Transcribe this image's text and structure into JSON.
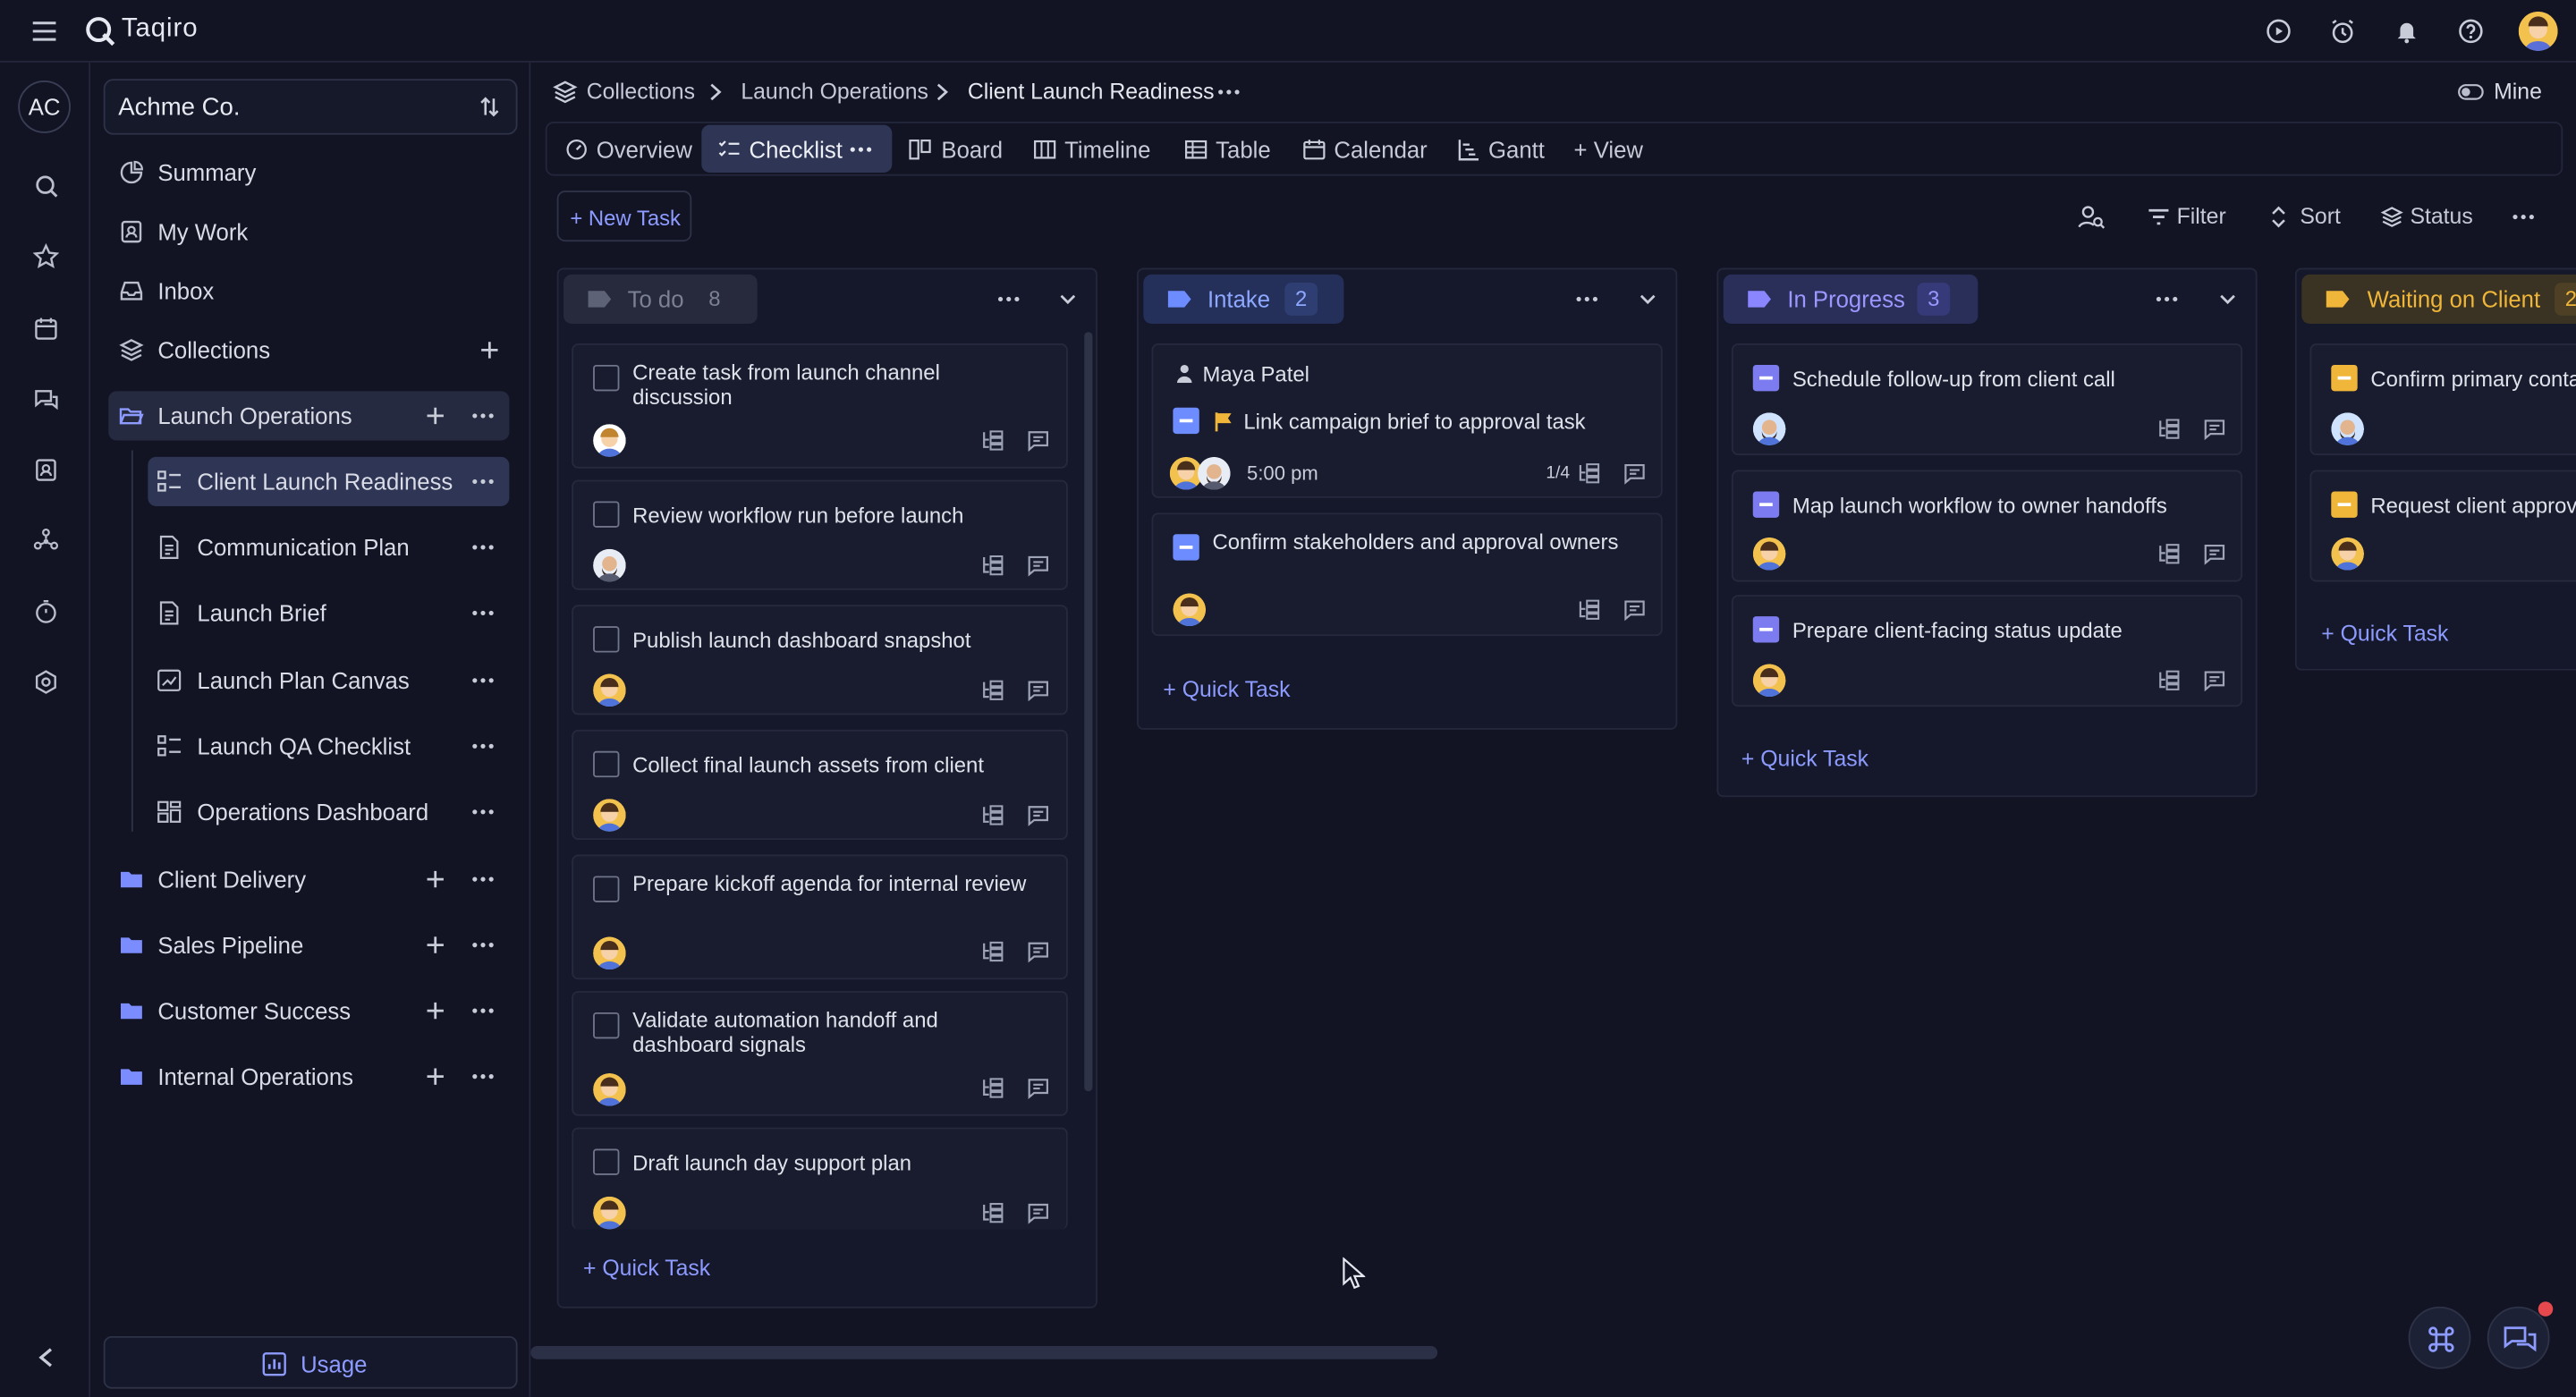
{
  "app": {
    "name": "Taqiro"
  },
  "workspace": {
    "initials": "AC",
    "name": "Achme Co."
  },
  "nav": {
    "summary": "Summary",
    "my_work": "My Work",
    "inbox": "Inbox",
    "collections": "Collections"
  },
  "tree": {
    "launch_operations": "Launch Operations",
    "items": [
      "Client Launch Readiness",
      "Communication Plan",
      "Launch Brief",
      "Launch Plan Canvas",
      "Launch QA Checklist",
      "Operations Dashboard"
    ],
    "folders": [
      "Client Delivery",
      "Sales Pipeline",
      "Customer Success",
      "Internal Operations"
    ]
  },
  "usage_label": "Usage",
  "breadcrumb": {
    "c1": "Collections",
    "c2": "Launch Operations",
    "c3": "Client Launch Readiness"
  },
  "mine_label": "Mine",
  "tabs": {
    "overview": "Overview",
    "checklist": "Checklist",
    "board": "Board",
    "timeline": "Timeline",
    "table": "Table",
    "calendar": "Calendar",
    "gantt": "Gantt",
    "add_view": "+ View"
  },
  "toolbar": {
    "new_task": "+ New Task",
    "filter": "Filter",
    "sort": "Sort",
    "status": "Status"
  },
  "quick_task": "+ Quick Task",
  "columns": {
    "todo": {
      "name": "To do",
      "count": "8",
      "cards": [
        "Create task from launch channel discussion",
        "Review workflow run before launch",
        "Publish launch dashboard snapshot",
        "Collect final launch assets from client",
        "Prepare kickoff agenda for internal review",
        "Validate automation handoff and dashboard signals",
        "Draft launch day support plan"
      ]
    },
    "intake": {
      "name": "Intake",
      "count": "2",
      "cards": [
        {
          "assignee": "Maya Patel",
          "title": "Link campaign brief to approval task",
          "time": "5:00 pm",
          "subtasks": "1/4"
        },
        {
          "title": "Confirm stakeholders and approval owners"
        }
      ]
    },
    "in_progress": {
      "name": "In Progress",
      "count": "3",
      "cards": [
        "Schedule follow-up from client call",
        "Map launch workflow to owner handoffs",
        "Prepare client-facing status update"
      ]
    },
    "waiting": {
      "name": "Waiting on Client",
      "count": "2",
      "cards": [
        "Confirm primary conta",
        "Request client approva"
      ]
    }
  },
  "colors": {
    "accent": "#8d9bff",
    "intake": "#6c8cff",
    "in_progress": "#7c7cf0",
    "waiting": "#f0b63a",
    "background": "#121424"
  }
}
